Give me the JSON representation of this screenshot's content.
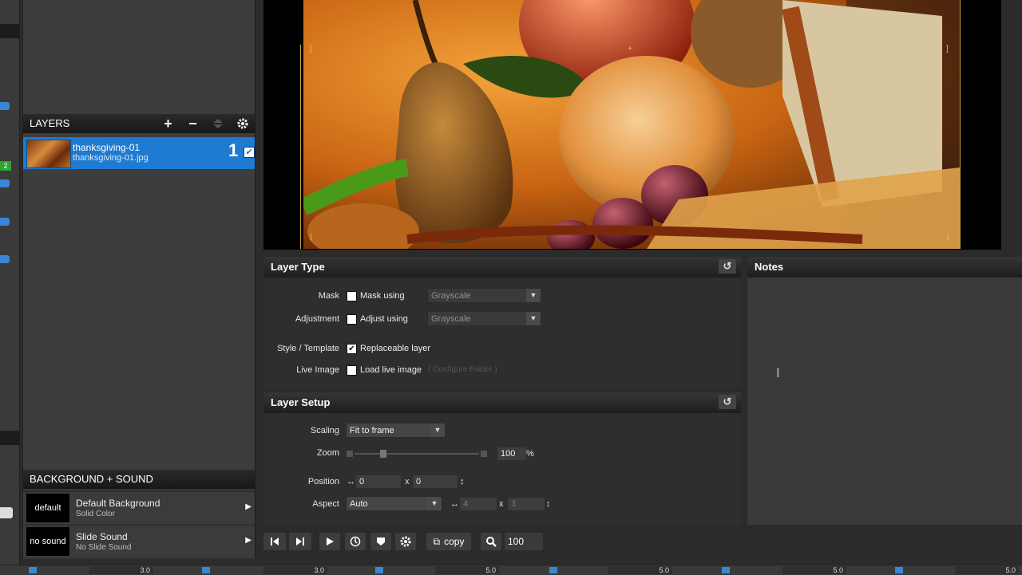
{
  "layers_panel": {
    "title": "LAYERS",
    "add_symbol": "+",
    "remove_symbol": "−",
    "settings_icon": "gear-icon",
    "layers": [
      {
        "title": "thanksgiving-01",
        "file": "thanksgiving-01.jpg",
        "number": "1",
        "checked": true
      }
    ]
  },
  "background_sound": {
    "title": "BACKGROUND + SOUND",
    "rows": [
      {
        "tag": "default",
        "title": "Default Background",
        "subtitle": "Solid Color"
      },
      {
        "tag": "no sound",
        "title": "Slide Sound",
        "subtitle": "No Slide Sound"
      }
    ]
  },
  "layer_type": {
    "title": "Layer Type",
    "mask_label": "Mask",
    "mask_check_text": "Mask using",
    "mask_select": "Grayscale",
    "adjustment_label": "Adjustment",
    "adjustment_check_text": "Adjust using",
    "adjustment_select": "Grayscale",
    "style_label": "Style / Template",
    "style_check_text": "Replaceable layer",
    "live_label": "Live Image",
    "live_check_text": "Load live image",
    "configure_folder": "( Configure Folder )"
  },
  "layer_setup": {
    "title": "Layer Setup",
    "scaling_label": "Scaling",
    "scaling_value": "Fit to frame",
    "zoom_label": "Zoom",
    "zoom_value": "100",
    "zoom_unit": "%",
    "position_label": "Position",
    "position_x": "0",
    "position_sep": "x",
    "position_y": "0",
    "aspect_label": "Aspect",
    "aspect_value": "Auto",
    "aspect_w": "4",
    "aspect_sep": "x",
    "aspect_h": "3"
  },
  "notes": {
    "title": "Notes"
  },
  "toolbar": {
    "copy_label": "copy",
    "zoom_value": "100"
  },
  "timeline": {
    "durations": [
      "3.0",
      "3.0",
      "5.0",
      "5.0",
      "5.0",
      "5.0"
    ]
  },
  "left_strip": {
    "badge": "2"
  },
  "colors": {
    "accent": "#1f7ad1",
    "highlight": "#e8c24a"
  }
}
